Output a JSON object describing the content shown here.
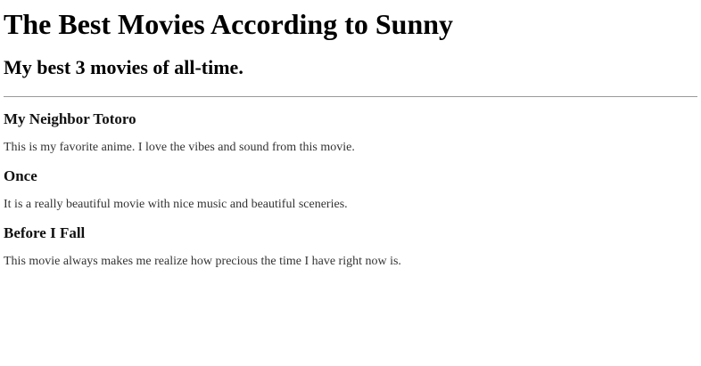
{
  "header": {
    "title": "The Best Movies According to Sunny",
    "subtitle": "My best 3 movies of all-time."
  },
  "movies": [
    {
      "title": "My Neighbor Totoro",
      "description": "This is my favorite anime. I love the vibes and sound from this movie."
    },
    {
      "title": "Once",
      "description": "It is a really beautiful movie with nice music and beautiful sceneries."
    },
    {
      "title": "Before I Fall",
      "description": "This movie always makes me realize how precious the time I have right now is."
    }
  ],
  "colors": {
    "text": "#000000",
    "divider": "#9a9a9a",
    "background": "#ffffff"
  }
}
